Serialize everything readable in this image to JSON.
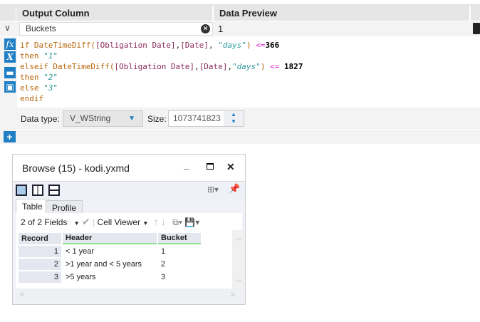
{
  "formula": {
    "headers": {
      "output_column": "Output Column",
      "data_preview": "Data Preview"
    },
    "row": {
      "output_column_value": "Buckets",
      "preview_value": "1"
    },
    "code": {
      "l1": {
        "kw": "if",
        "fn": "DateTimeDiff(",
        "f1": "[Obligation Date]",
        "c": ",",
        "f2": "[Date]",
        "c2": ", ",
        "s": "\"days\"",
        "p": ")",
        "op": " <=",
        "n": "366"
      },
      "l2": {
        "kw": "then ",
        "s": "\"1\""
      },
      "l3": {
        "kw": "elseif",
        "fn": "DateTimeDiff(",
        "f1": "[Obligation Date]",
        "c": ",",
        "f2": "[Date]",
        "c2": ",",
        "s": "\"days\"",
        "p": ")",
        "op": " <= ",
        "n": "1827"
      },
      "l4": {
        "kw": "then ",
        "s": "\"2\""
      },
      "l5": {
        "kw": "else ",
        "s": "\"3\""
      },
      "l6": {
        "kw": "endif"
      }
    },
    "data_type_label": "Data type:",
    "data_type_value": "V_WString",
    "size_label": "Size:",
    "size_value": "1073741823",
    "add_label": "+"
  },
  "browse": {
    "title": "Browse (15) - kodi.yxmd",
    "tabs": [
      "Table",
      "Profile"
    ],
    "fields": "2 of 2 Fields",
    "cell_viewer": "Cell Viewer",
    "columns": [
      "Record",
      "Header",
      "Bucket"
    ],
    "rows": [
      [
        "1",
        "< 1 year",
        "1"
      ],
      [
        "2",
        ">1 year and < 5 years",
        "2"
      ],
      [
        "3",
        ">5 years",
        "3"
      ]
    ]
  },
  "colors": {
    "accent": "#1f7fc4"
  }
}
